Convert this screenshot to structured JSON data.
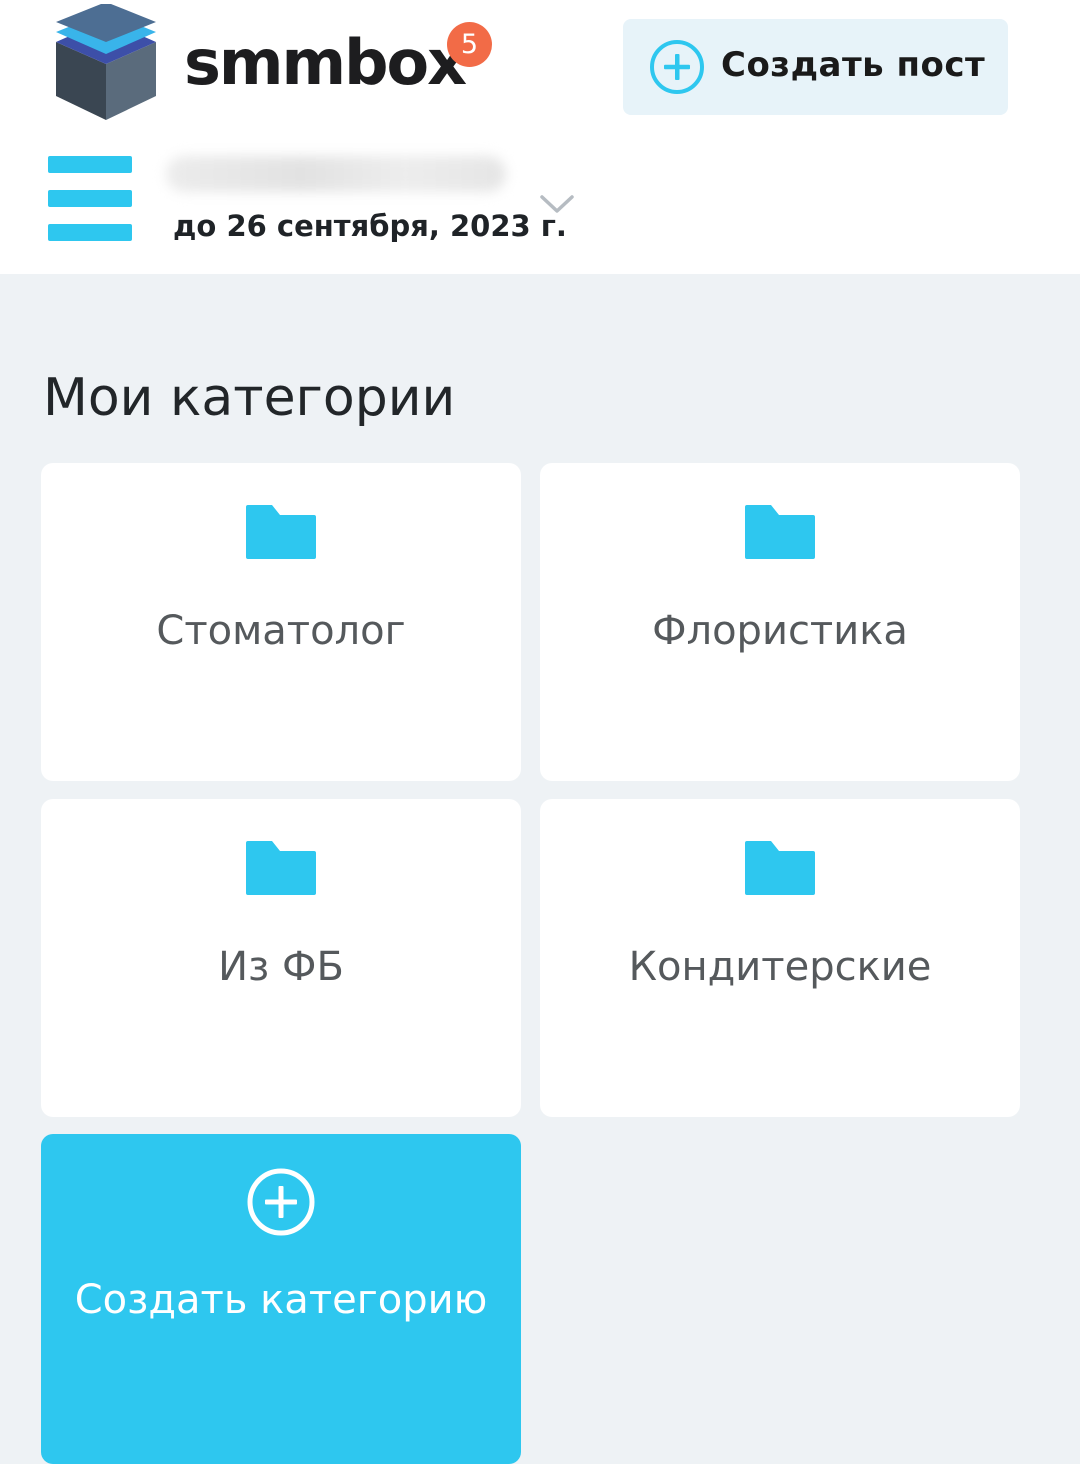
{
  "header": {
    "brand": "smmbox",
    "notification_count": "5",
    "create_post_label": "Создать пост",
    "account": {
      "expire_date": "до 26 сентября, 2023 г."
    }
  },
  "main": {
    "title": "Мои категории",
    "categories": [
      {
        "name": "Стоматолог"
      },
      {
        "name": "Флористика"
      },
      {
        "name": "Из ФБ"
      },
      {
        "name": "Кондитерские"
      }
    ],
    "create_category_label": "Создать категорию"
  },
  "colors": {
    "accent": "#2ec7ef",
    "badge": "#f26b47",
    "create_post_bg": "#e7f3f9",
    "page_bg": "#eef2f5"
  },
  "icons": {
    "logo": "layered-box-icon",
    "create_post": "plus-circle-icon",
    "menu": "hamburger-menu-icon",
    "account_dropdown": "chevron-down-icon",
    "category": "folder-icon",
    "create_category": "plus-circle-icon"
  }
}
